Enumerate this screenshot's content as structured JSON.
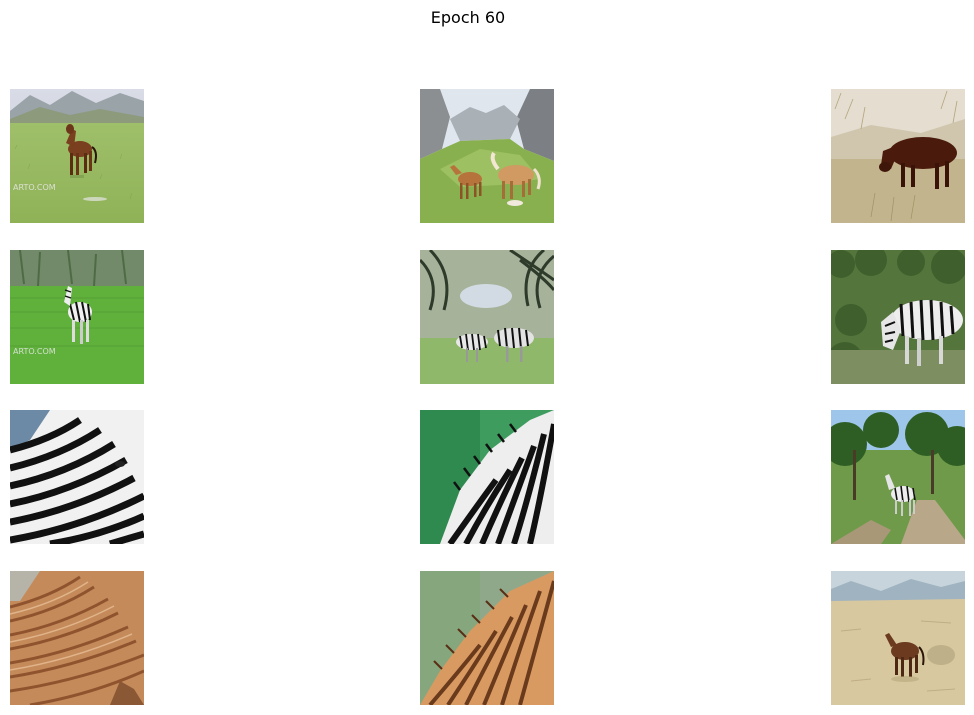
{
  "figure": {
    "title": "Epoch 60"
  },
  "panels": [
    {
      "row": 0,
      "col": 0,
      "subject": "brown horse standing in green meadow with mountains",
      "watermark": "ARTO.COM"
    },
    {
      "row": 0,
      "col": 1,
      "subject": "two horses in green alpine valley with grey mountains"
    },
    {
      "row": 0,
      "col": 2,
      "subject": "dark brown horse grazing in dry grass"
    },
    {
      "row": 1,
      "col": 0,
      "subject": "generated zebra standing in green meadow",
      "watermark": "ARTO.COM"
    },
    {
      "row": 1,
      "col": 1,
      "subject": "generated zebras in striped valley"
    },
    {
      "row": 1,
      "col": 2,
      "subject": "generated zebra grazing by bushes"
    },
    {
      "row": 2,
      "col": 0,
      "subject": "close-up zebra head and neck"
    },
    {
      "row": 2,
      "col": 1,
      "subject": "zebra neck and mane against green background"
    },
    {
      "row": 2,
      "col": 2,
      "subject": "zebra standing on dirt path among trees"
    },
    {
      "row": 3,
      "col": 0,
      "subject": "generated horse-textured zebra close-up, orange tones"
    },
    {
      "row": 3,
      "col": 1,
      "subject": "generated orange striped neck and mane"
    },
    {
      "row": 3,
      "col": 2,
      "subject": "generated horse standing on dry sandy ground"
    }
  ],
  "colors": {
    "meadow_green": "#7fae4a",
    "horse_brown": "#7a3f1e",
    "zebra_black": "#111111",
    "zebra_white": "#f2f2f2",
    "sky_blue": "#b8d3ec"
  }
}
